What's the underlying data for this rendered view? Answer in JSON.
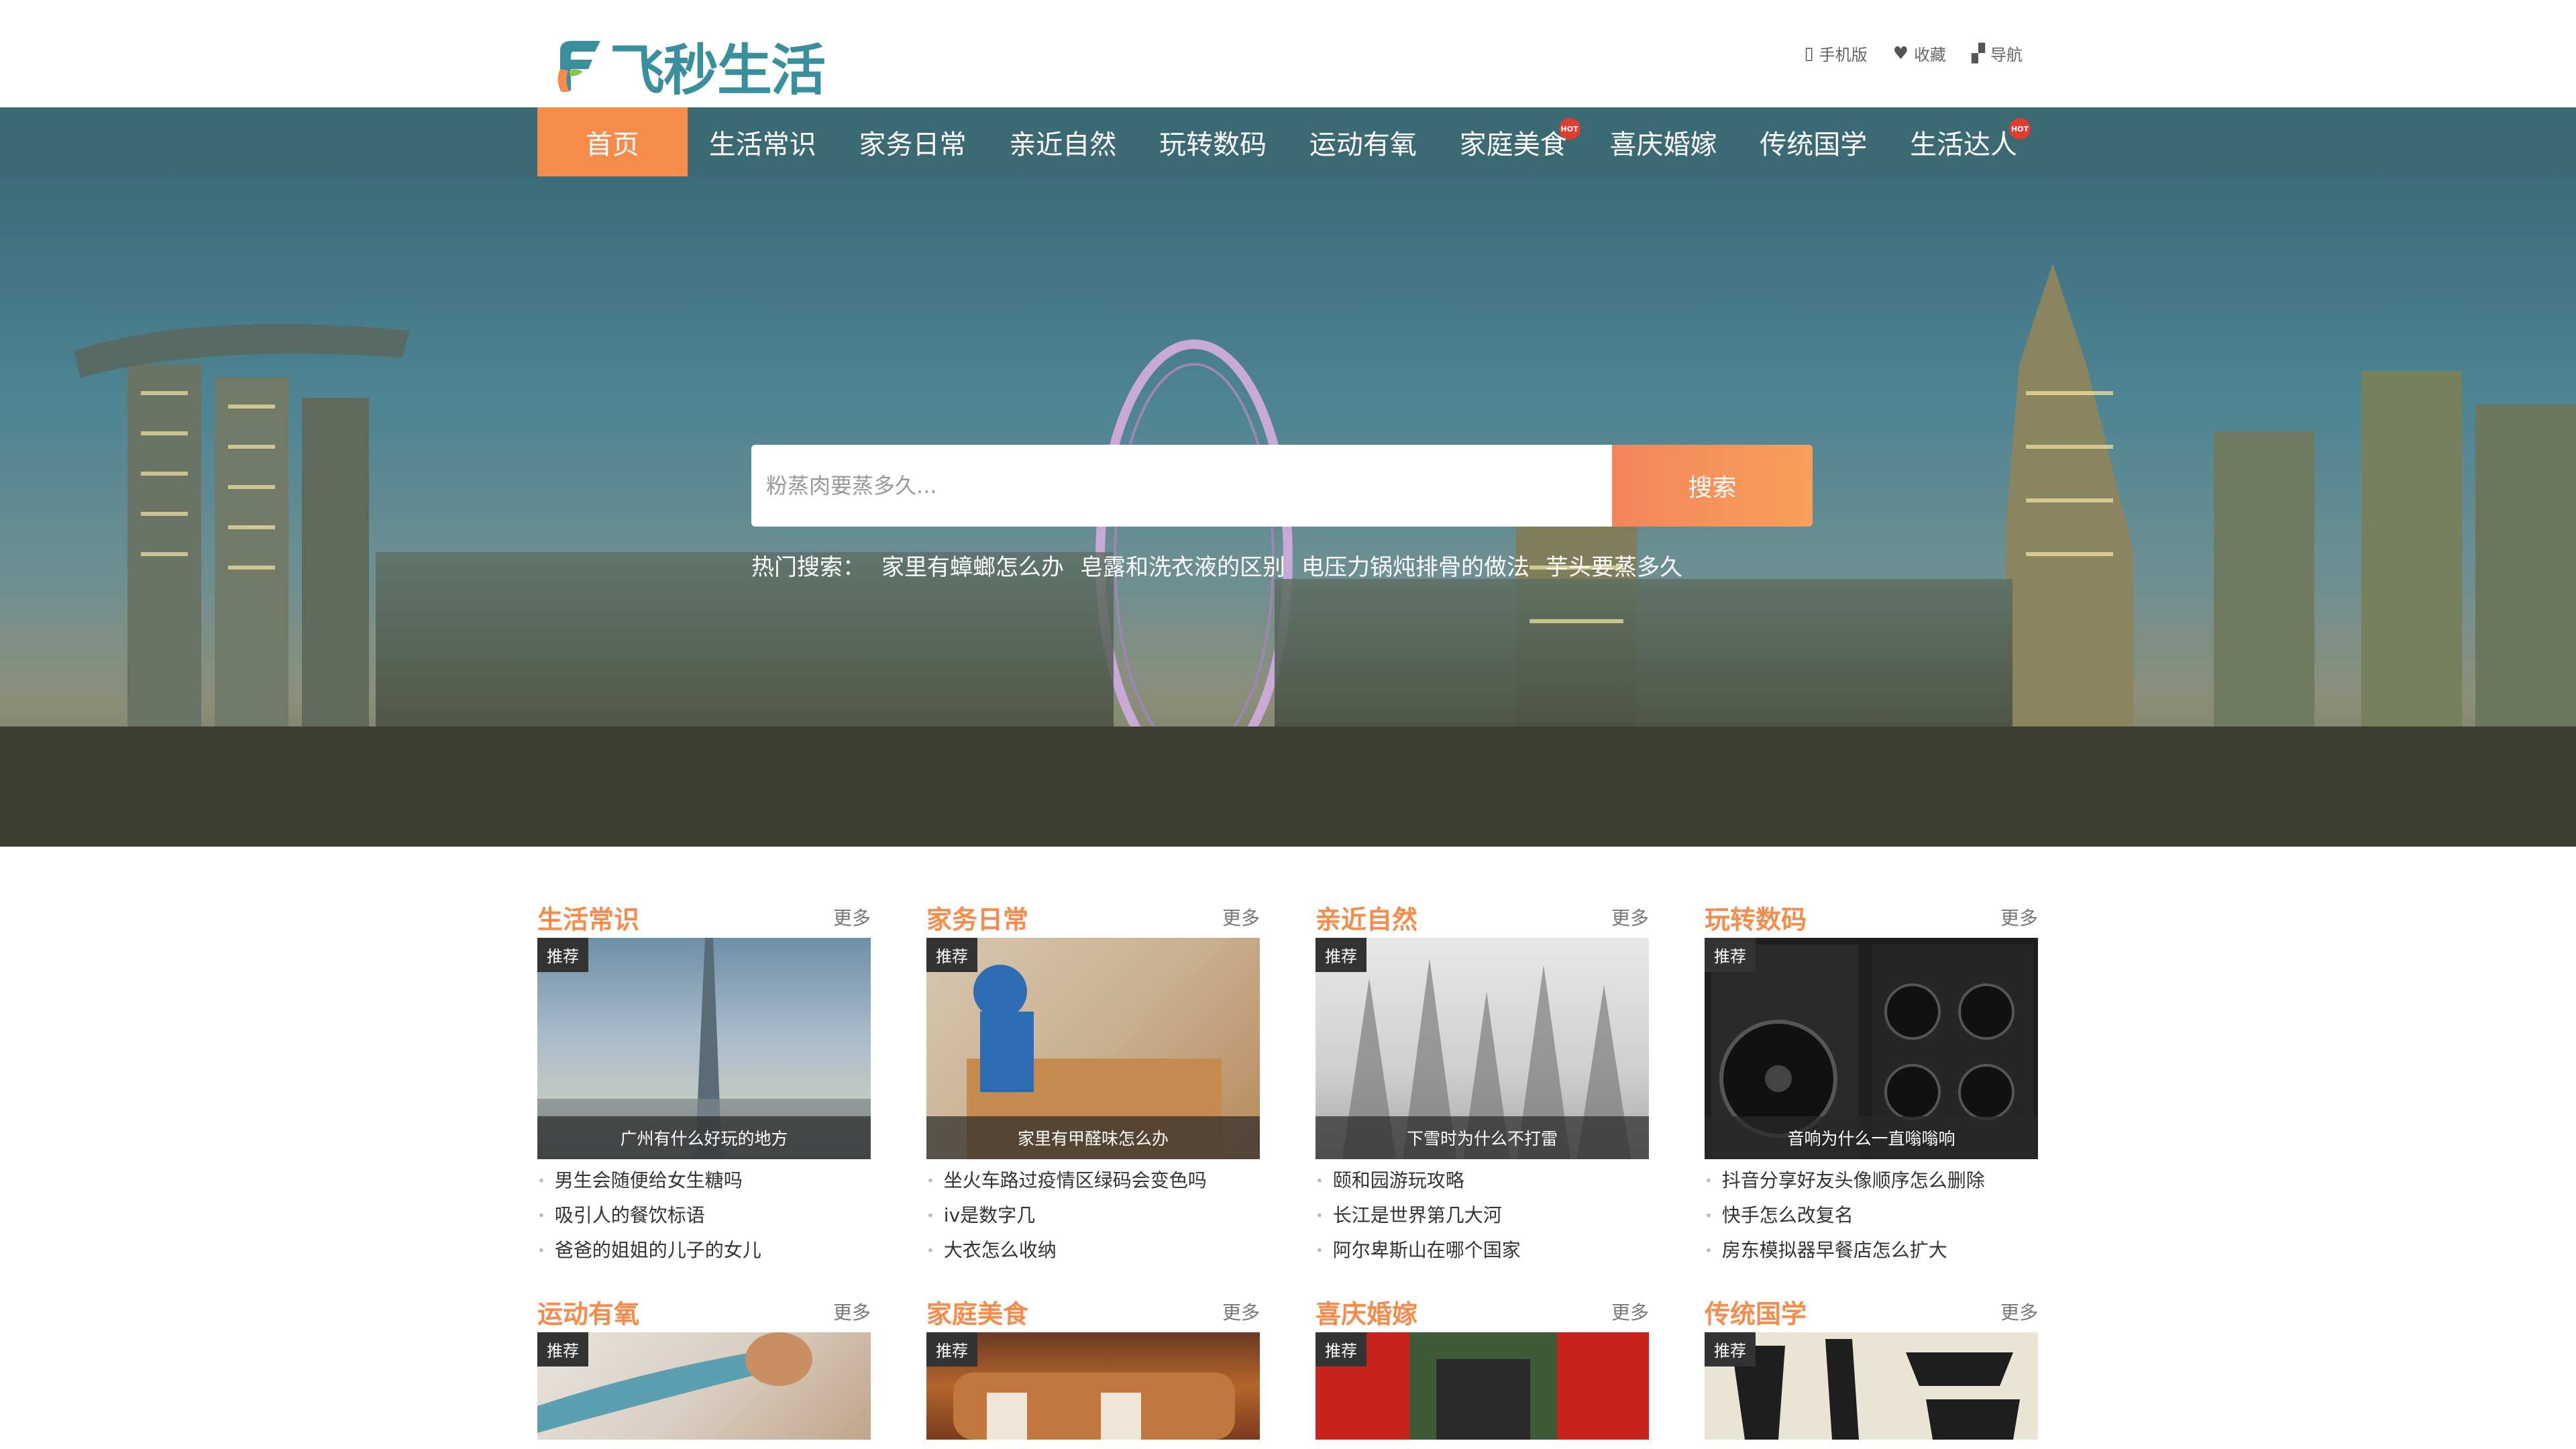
{
  "site": {
    "logo_text": "飞秒生活",
    "top_links": [
      {
        "icon": "mobile-icon",
        "label": "手机版"
      },
      {
        "icon": "heart-icon",
        "label": "收藏"
      },
      {
        "icon": "nav-grid-icon",
        "label": "导航"
      }
    ]
  },
  "nav": {
    "items": [
      {
        "label": "首页",
        "active": true,
        "hot": false
      },
      {
        "label": "生活常识",
        "hot": false
      },
      {
        "label": "家务日常",
        "hot": false
      },
      {
        "label": "亲近自然",
        "hot": false
      },
      {
        "label": "玩转数码",
        "hot": false
      },
      {
        "label": "运动有氧",
        "hot": false
      },
      {
        "label": "家庭美食",
        "hot": true
      },
      {
        "label": "喜庆婚嫁",
        "hot": false
      },
      {
        "label": "传统国学",
        "hot": false
      },
      {
        "label": "生活达人",
        "hot": true
      }
    ],
    "hot_badge": "HOT"
  },
  "search": {
    "placeholder": "粉蒸肉要蒸多久...",
    "button": "搜索",
    "hot_label": "热门搜索：",
    "hot_terms": [
      "家里有蟑螂怎么办",
      "皂露和洗衣液的区别",
      "电压力锅炖排骨的做法",
      "芋头要蒸多久"
    ]
  },
  "sections": [
    {
      "title": "生活常识",
      "more": "更多",
      "badge": "推荐",
      "caption": "广州有什么好玩的地方",
      "items": [
        "男生会随便给女生糖吗",
        "吸引人的餐饮标语",
        "爸爸的姐姐的儿子的女儿"
      ]
    },
    {
      "title": "家务日常",
      "more": "更多",
      "badge": "推荐",
      "caption": "家里有甲醛味怎么办",
      "items": [
        "坐火车路过疫情区绿码会变色吗",
        "iv是数字几",
        "大衣怎么收纳"
      ]
    },
    {
      "title": "亲近自然",
      "more": "更多",
      "badge": "推荐",
      "caption": "下雪时为什么不打雷",
      "items": [
        "颐和园游玩攻略",
        "长江是世界第几大河",
        "阿尔卑斯山在哪个国家"
      ]
    },
    {
      "title": "玩转数码",
      "more": "更多",
      "badge": "推荐",
      "caption": "音响为什么一直嗡嗡响",
      "items": [
        "抖音分享好友头像顺序怎么删除",
        "快手怎么改复名",
        "房东模拟器早餐店怎么扩大"
      ]
    },
    {
      "title": "运动有氧",
      "more": "更多",
      "badge": "推荐"
    },
    {
      "title": "家庭美食",
      "more": "更多",
      "badge": "推荐"
    },
    {
      "title": "喜庆婚嫁",
      "more": "更多",
      "badge": "推荐"
    },
    {
      "title": "传统国学",
      "more": "更多",
      "badge": "推荐"
    }
  ],
  "colors": {
    "accent": "#f58c4c",
    "nav_bg": "#3b6a75",
    "logo": "#3a8f9c"
  }
}
